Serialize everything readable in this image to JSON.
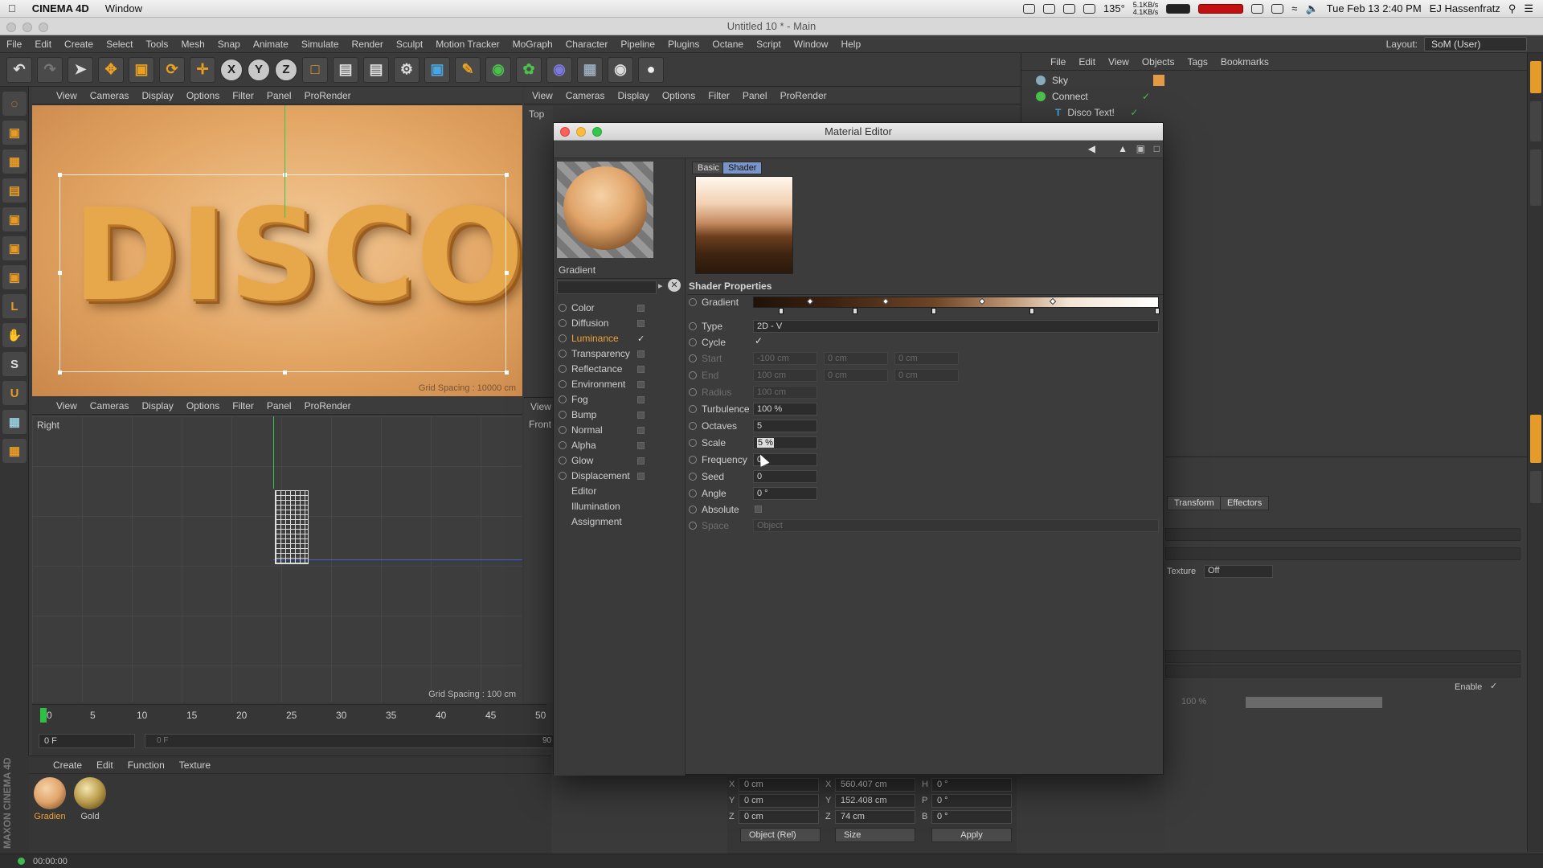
{
  "mac_menubar": {
    "app_name": "CINEMA 4D",
    "menu": "Window",
    "temperature": "135°",
    "net_up": "5.1KB/s",
    "net_down": "4.1KB/s",
    "datetime": "Tue Feb 13  2:40 PM",
    "user": "EJ Hassenfratz"
  },
  "window_title": "Untitled 10 * - Main",
  "main_menu": [
    "File",
    "Edit",
    "Create",
    "Select",
    "Tools",
    "Mesh",
    "Snap",
    "Animate",
    "Simulate",
    "Render",
    "Sculpt",
    "Motion Tracker",
    "MoGraph",
    "Character",
    "Pipeline",
    "Plugins",
    "Octane",
    "Script",
    "Window",
    "Help"
  ],
  "layout": {
    "label": "Layout:",
    "value": "SoM (User)"
  },
  "toolbar": {
    "x": "X",
    "y": "Y",
    "z": "Z"
  },
  "viewport_menu": [
    "View",
    "Cameras",
    "Display",
    "Options",
    "Filter",
    "Panel",
    "ProRender"
  ],
  "viewport1": {
    "text": "DISCO",
    "grid_spacing": "Grid Spacing : 10000 cm"
  },
  "viewport2": {
    "label": "Right",
    "grid_spacing": "Grid Spacing : 100 cm"
  },
  "viewport3": {
    "label": "Top"
  },
  "viewport4": {
    "label": "Front",
    "menu_first": "View"
  },
  "timeline": {
    "ticks": [
      "0",
      "5",
      "10",
      "15",
      "20",
      "25",
      "30",
      "35",
      "40",
      "45",
      "50"
    ],
    "current_frame": "0 F",
    "range_start": "0 F",
    "range_end": "90 F"
  },
  "material_manager": {
    "menu": [
      "Create",
      "Edit",
      "Function",
      "Texture"
    ],
    "materials": [
      {
        "name": "Gradien",
        "color": "#e0a46a",
        "active": true
      },
      {
        "name": "Gold",
        "color": "#b99a4a",
        "active": false
      }
    ]
  },
  "status_bar": {
    "time": "00:00:00"
  },
  "maxon_logo": "MAXON CINEMA 4D",
  "object_manager": {
    "menu": [
      "File",
      "Edit",
      "View",
      "Objects",
      "Tags",
      "Bookmarks"
    ],
    "objects": [
      {
        "name": "Sky"
      },
      {
        "name": "Connect"
      },
      {
        "name": "Disco Text!"
      }
    ]
  },
  "attributes": {
    "tabs": [
      "Transform",
      "Effectors"
    ],
    "texture_label": "Texture",
    "texture_value": "Off",
    "enable_label": "Enable",
    "strength_value": "100 %"
  },
  "coordinates": {
    "pos": [
      {
        "axis": "X",
        "value": "0 cm"
      },
      {
        "axis": "Y",
        "value": "0 cm"
      },
      {
        "axis": "Z",
        "value": "0 cm"
      }
    ],
    "size": [
      {
        "axis": "X",
        "value": "560.407 cm"
      },
      {
        "axis": "Y",
        "value": "152.408 cm"
      },
      {
        "axis": "Z",
        "value": "74 cm"
      }
    ],
    "rot": [
      {
        "axis": "H",
        "value": "0 °"
      },
      {
        "axis": "P",
        "value": "0 °"
      },
      {
        "axis": "B",
        "value": "0 °"
      }
    ],
    "mode": "Object (Rel)",
    "size_mode": "Size",
    "apply": "Apply"
  },
  "material_editor": {
    "title": "Material Editor",
    "material_name": "Gradient",
    "channels": [
      {
        "name": "Color",
        "checked": false,
        "active": false
      },
      {
        "name": "Diffusion",
        "checked": false,
        "active": false
      },
      {
        "name": "Luminance",
        "checked": true,
        "active": true
      },
      {
        "name": "Transparency",
        "checked": false,
        "active": false
      },
      {
        "name": "Reflectance",
        "checked": false,
        "active": false
      },
      {
        "name": "Environment",
        "checked": false,
        "active": false
      },
      {
        "name": "Fog",
        "checked": false,
        "active": false
      },
      {
        "name": "Bump",
        "checked": false,
        "active": false
      },
      {
        "name": "Normal",
        "checked": false,
        "active": false
      },
      {
        "name": "Alpha",
        "checked": false,
        "active": false
      },
      {
        "name": "Glow",
        "checked": false,
        "active": false
      },
      {
        "name": "Displacement",
        "checked": false,
        "active": false
      }
    ],
    "extra": [
      "Editor",
      "Illumination",
      "Assignment"
    ],
    "tabs": [
      "Basic",
      "Shader"
    ],
    "section_title": "Shader Properties",
    "props": {
      "gradient": "Gradient",
      "type_label": "Type",
      "type_value": "2D - V",
      "cycle_label": "Cycle",
      "start_label": "Start",
      "start": [
        "-100 cm",
        "0 cm",
        "0 cm"
      ],
      "end_label": "End",
      "end": [
        "100 cm",
        "0 cm",
        "0 cm"
      ],
      "radius_label": "Radius",
      "radius": "100 cm",
      "turbulence_label": "Turbulence",
      "turbulence": "100 %",
      "octaves_label": "Octaves",
      "octaves": "5",
      "scale_label": "Scale",
      "scale": "5 %",
      "frequency_label": "Frequency",
      "frequency": "0",
      "seed_label": "Seed",
      "seed": "0",
      "angle_label": "Angle",
      "angle": "0 °",
      "absolute_label": "Absolute",
      "space_label": "Space",
      "space": "Object"
    }
  }
}
